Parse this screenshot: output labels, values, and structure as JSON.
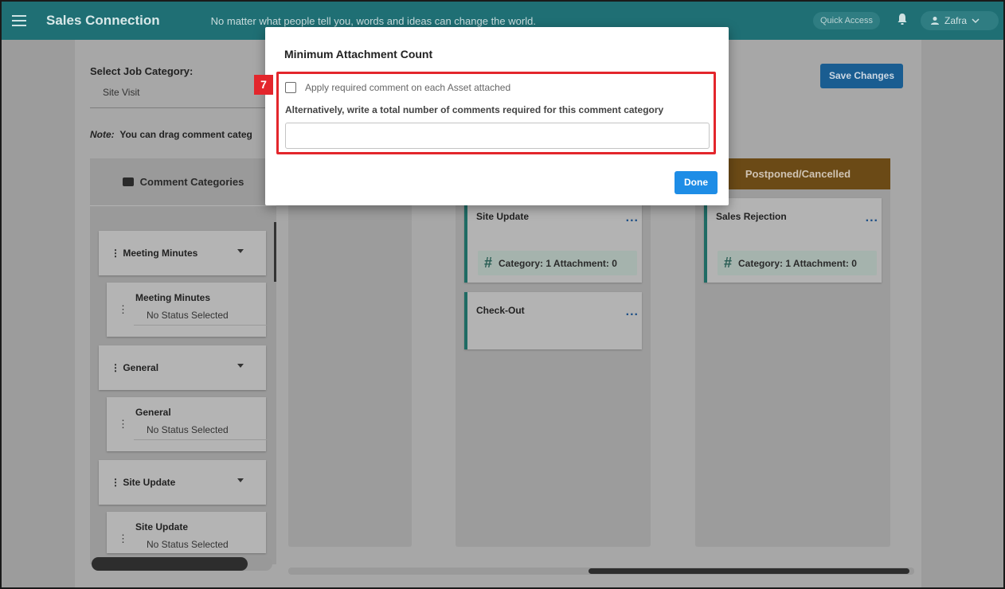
{
  "app": {
    "name": "Sales Connection",
    "tagline": "No matter what people tell you, words and ideas can change the world.",
    "quick_access": "Quick Access",
    "user": "Zafra"
  },
  "page": {
    "select_label": "Select Job Category:",
    "selected_category": "Site Visit",
    "note_prefix": "Note:",
    "note_text": "You can drag comment categ",
    "save_label": "Save Changes"
  },
  "categories_panel": {
    "title": "Comment Categories",
    "groups": [
      {
        "label": "Meeting Minutes",
        "child_title": "Meeting Minutes",
        "child_status": "No Status Selected"
      },
      {
        "label": "General",
        "child_title": "General",
        "child_status": "No Status Selected"
      },
      {
        "label": "Site Update",
        "child_title": "Site Update",
        "child_status": "No Status Selected"
      }
    ]
  },
  "columns": {
    "postponed_header": "Postponed/Cancelled",
    "cards": [
      {
        "title": "Site Update",
        "badge": "Category: 1 Attachment: 0"
      },
      {
        "title": "Check-Out"
      },
      {
        "title": "Sales Rejection",
        "badge": "Category: 1 Attachment: 0"
      }
    ],
    "more_glyph": "..."
  },
  "modal": {
    "title": "Minimum Attachment Count",
    "step_number": "7",
    "checkbox_label": "Apply required comment on each Asset attached",
    "alt_label": "Alternatively, write a total number of comments required for this comment category",
    "input_value": "",
    "done_label": "Done"
  },
  "colors": {
    "topbar": "#1f6f74",
    "highlight": "#e3262c",
    "done_button": "#1e8de6",
    "postponed_header": "#6b4a16"
  }
}
